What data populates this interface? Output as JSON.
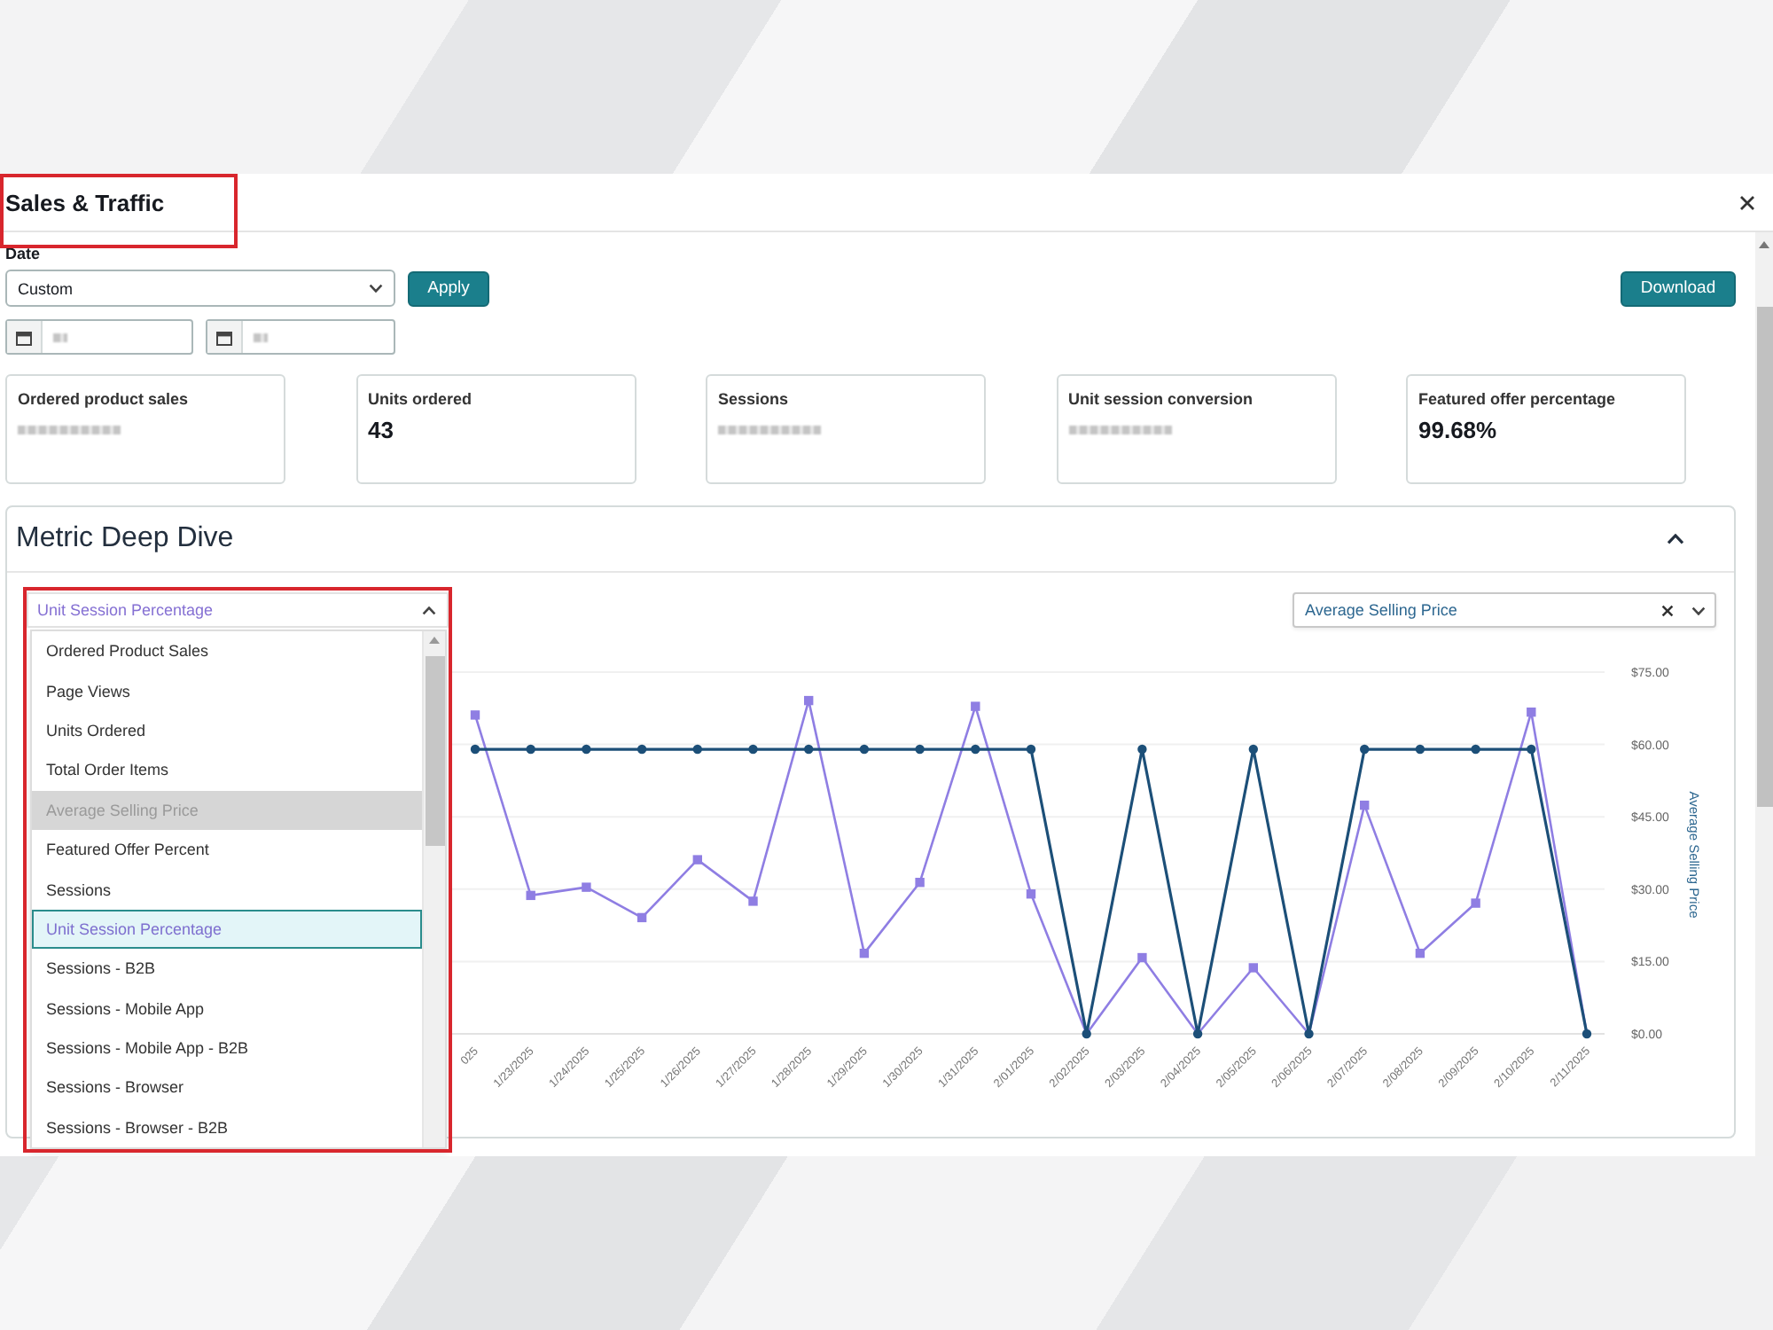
{
  "dialog": {
    "title": "Sales & Traffic",
    "title_highlighted": true
  },
  "date_filter": {
    "label": "Date",
    "range": "Custom",
    "apply": "Apply",
    "start_date": {
      "redacted": true
    },
    "end_date": {
      "redacted": true
    }
  },
  "download": "Download",
  "metrics": [
    {
      "label": "Ordered product sales",
      "redacted": true
    },
    {
      "label": "Units ordered",
      "value": "43",
      "redacted": false
    },
    {
      "label": "Sessions",
      "redacted": true
    },
    {
      "label": "Unit session conversion",
      "redacted": true
    },
    {
      "label": "Featured offer percentage",
      "value": "99.68%",
      "redacted": false
    }
  ],
  "deep_dive": {
    "title": "Metric Deep Dive",
    "expanded": true,
    "metric_select": {
      "value": "Unit Session Percentage",
      "open": true,
      "highlighted": true,
      "options": [
        {
          "label": "Ordered Product Sales",
          "selected": false,
          "disabled": false
        },
        {
          "label": "Page Views",
          "selected": false,
          "disabled": false
        },
        {
          "label": "Units Ordered",
          "selected": false,
          "disabled": false
        },
        {
          "label": "Total Order Items",
          "selected": false,
          "disabled": false
        },
        {
          "label": "Average Selling Price",
          "selected": false,
          "disabled": true
        },
        {
          "label": "Featured Offer Percent",
          "selected": false,
          "disabled": false
        },
        {
          "label": "Sessions",
          "selected": false,
          "disabled": false
        },
        {
          "label": "Unit Session Percentage",
          "selected": true,
          "disabled": false
        },
        {
          "label": "Sessions - B2B",
          "selected": false,
          "disabled": false
        },
        {
          "label": "Sessions - Mobile App",
          "selected": false,
          "disabled": false
        },
        {
          "label": "Sessions - Mobile App - B2B",
          "selected": false,
          "disabled": false
        },
        {
          "label": "Sessions - Browser",
          "selected": false,
          "disabled": false
        },
        {
          "label": "Sessions - Browser - B2B",
          "selected": false,
          "disabled": false
        }
      ]
    },
    "series_select": {
      "value": "Average Selling Price"
    },
    "chart_data": {
      "type": "line",
      "ylabel": "Average Selling Price",
      "grid": true,
      "categories": [
        "025",
        "1/23/2025",
        "1/24/2025",
        "1/25/2025",
        "1/26/2025",
        "1/27/2025",
        "1/28/2025",
        "1/29/2025",
        "1/30/2025",
        "1/31/2025",
        "2/01/2025",
        "2/02/2025",
        "2/03/2025",
        "2/04/2025",
        "2/05/2025",
        "2/06/2025",
        "2/07/2025",
        "2/08/2025",
        "2/09/2025",
        "2/10/2025",
        "2/11/2025"
      ],
      "series": [
        {
          "color": "#8f7ee3",
          "marker": "square",
          "values": [
            66.1,
            28.7,
            30.4,
            24.1,
            36.1,
            27.5,
            69.1,
            16.7,
            31.4,
            67.9,
            29,
            0,
            15.8,
            0,
            13.7,
            0,
            47.4,
            16.7,
            27.1,
            66.7,
            0
          ]
        },
        {
          "color": "#1c4f78",
          "marker": "circle",
          "values": [
            59,
            59,
            59,
            59,
            59,
            59,
            59,
            59,
            59,
            59,
            59,
            0,
            59,
            0,
            59,
            0,
            59,
            59,
            59,
            59,
            0
          ]
        }
      ],
      "ylim": [
        0,
        75
      ],
      "yticks": [
        {
          "value": 0,
          "label": "$0.00"
        },
        {
          "value": 15,
          "label": "$15.00"
        },
        {
          "value": 30,
          "label": "$30.00"
        },
        {
          "value": 45,
          "label": "$45.00"
        },
        {
          "value": 60,
          "label": "$60.00"
        },
        {
          "value": 75,
          "label": "$75.00"
        }
      ]
    }
  }
}
